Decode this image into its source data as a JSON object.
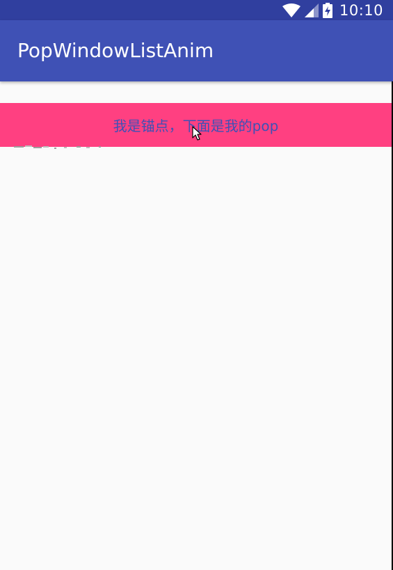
{
  "status_bar": {
    "time": "10:10",
    "icons": [
      "wifi-icon",
      "signal-icon",
      "battery-charging-icon"
    ]
  },
  "app_bar": {
    "title": "PopWindowListAnim"
  },
  "anchor": {
    "label": "我是锚点，下面是我的pop"
  },
  "colors": {
    "status_bar": "#303f9f",
    "app_bar": "#3f51b5",
    "accent": "#ff4081",
    "background": "#fafafa",
    "anchor_text": "#3f51b5"
  }
}
